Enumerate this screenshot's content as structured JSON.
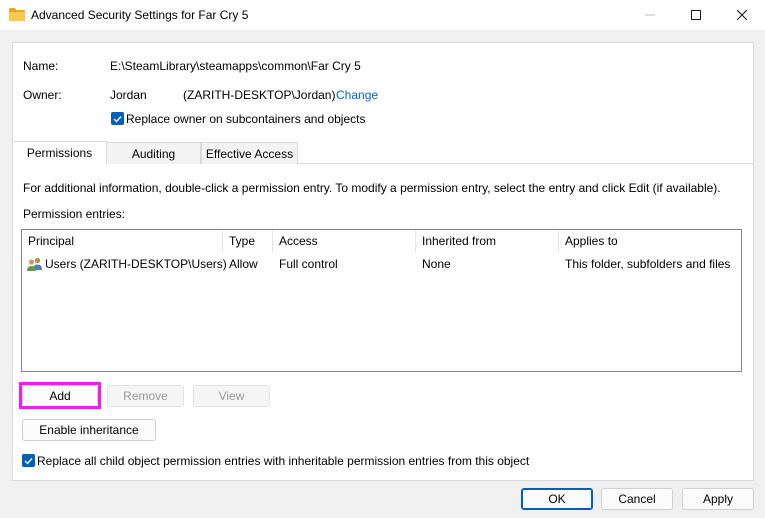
{
  "window": {
    "title": "Advanced Security Settings for Far Cry 5"
  },
  "info": {
    "name_label": "Name:",
    "name_value": "E:\\SteamLibrary\\steamapps\\common\\Far Cry 5",
    "owner_label": "Owner:",
    "owner_name": "Jordan",
    "owner_account": "(ZARITH-DESKTOP\\Jordan)",
    "change_link": "Change",
    "replace_owner_label": "Replace owner on subcontainers and objects",
    "replace_owner_checked": true
  },
  "tabs": [
    {
      "label": "Permissions",
      "active": true
    },
    {
      "label": "Auditing",
      "active": false
    },
    {
      "label": "Effective Access",
      "active": false
    }
  ],
  "permissions": {
    "info_text": "For additional information, double-click a permission entry. To modify a permission entry, select the entry and click Edit (if available).",
    "entries_label": "Permission entries:",
    "columns": [
      "Principal",
      "Type",
      "Access",
      "Inherited from",
      "Applies to"
    ],
    "rows": [
      {
        "principal": "Users (ZARITH-DESKTOP\\Users)",
        "type": "Allow",
        "access": "Full control",
        "inherited_from": "None",
        "applies_to": "This folder, subfolders and files"
      }
    ],
    "buttons": {
      "add": "Add",
      "remove": "Remove",
      "view": "View",
      "enable_inheritance": "Enable inheritance"
    },
    "replace_child_label": "Replace all child object permission entries with inheritable permission entries from this object",
    "replace_child_checked": true
  },
  "footer": {
    "ok": "OK",
    "cancel": "Cancel",
    "apply": "Apply"
  },
  "colors": {
    "accent": "#005fb8",
    "link": "#0067c0",
    "highlight": "#ee20ee"
  }
}
